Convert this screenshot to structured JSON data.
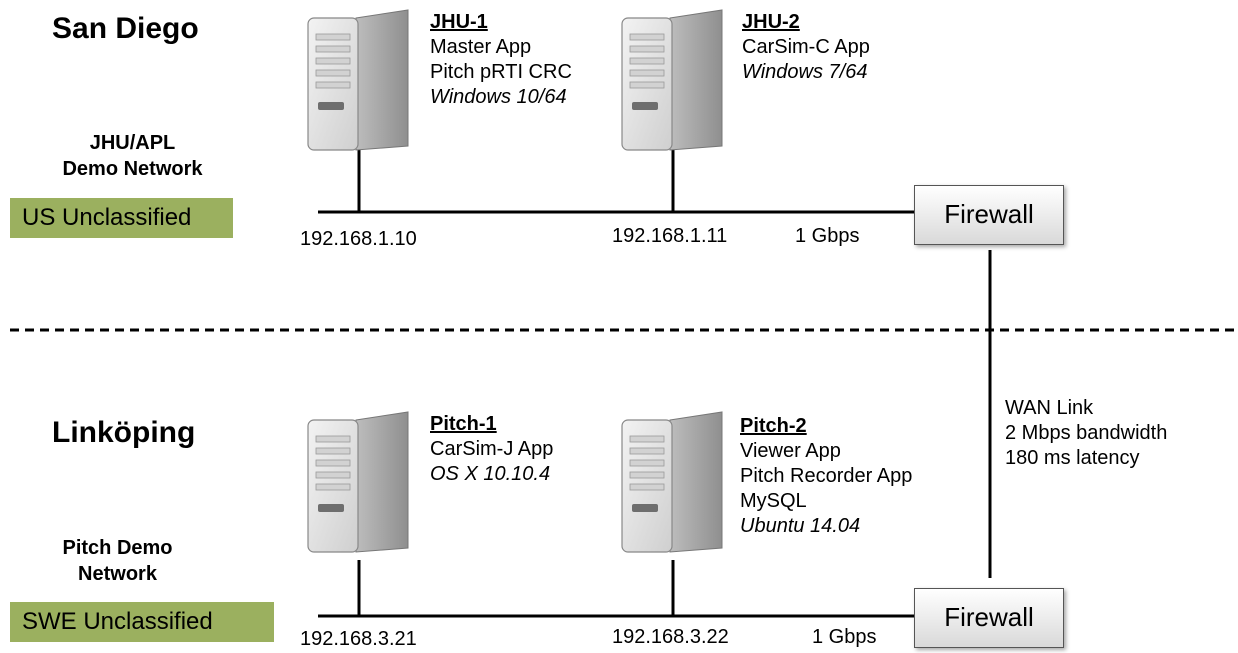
{
  "sites": [
    {
      "title": "San Diego",
      "network": [
        "JHU/APL",
        "Demo Network"
      ],
      "classification": "US Unclassified",
      "speed": "1 Gbps",
      "servers": [
        {
          "name": "JHU-1",
          "lines": [
            "Master App",
            "Pitch pRTI CRC"
          ],
          "os": "Windows 10/64",
          "ip": "192.168.1.10"
        },
        {
          "name": "JHU-2",
          "lines": [
            "CarSim-C App"
          ],
          "os": "Windows 7/64",
          "ip": "192.168.1.11"
        }
      ],
      "firewall": "Firewall"
    },
    {
      "title": "Linköping",
      "network": [
        "Pitch Demo",
        "Network"
      ],
      "classification": "SWE Unclassified",
      "speed": "1 Gbps",
      "servers": [
        {
          "name": "Pitch-1",
          "lines": [
            "CarSim-J App"
          ],
          "os": "OS X 10.10.4",
          "ip": "192.168.3.21"
        },
        {
          "name": "Pitch-2",
          "lines": [
            "Viewer App",
            "Pitch Recorder App",
            "MySQL"
          ],
          "os": "Ubuntu 14.04",
          "ip": "192.168.3.22"
        }
      ],
      "firewall": "Firewall"
    }
  ],
  "wan": [
    "WAN Link",
    "2 Mbps bandwidth",
    "180 ms latency"
  ],
  "colors": {
    "badge": "#9bb05f",
    "line": "#000000",
    "server_body": "#e6e6e6"
  }
}
